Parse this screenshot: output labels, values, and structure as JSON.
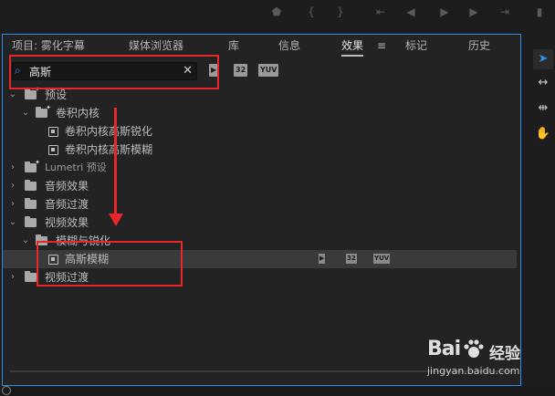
{
  "transport": {
    "icons": [
      "marker-icon",
      "in-point-icon",
      "out-point-icon",
      "go-to-in-icon",
      "step-back-icon",
      "play-icon",
      "step-forward-icon",
      "go-to-out-icon"
    ]
  },
  "tabs": [
    {
      "label": "项目: 雾化字幕"
    },
    {
      "label": "媒体浏览器"
    },
    {
      "label": "库"
    },
    {
      "label": "信息"
    },
    {
      "label": "效果",
      "active": true
    },
    {
      "label": "标记"
    },
    {
      "label": "历史"
    }
  ],
  "search": {
    "value": "高斯",
    "placeholder": ""
  },
  "filters": {
    "accelerated": "▶",
    "bit32": "32",
    "yuv": "YUV"
  },
  "tree": [
    {
      "label": "预设",
      "level": 0,
      "expanded": true,
      "type": "folder-star"
    },
    {
      "label": "卷积内核",
      "level": 1,
      "expanded": true,
      "type": "folder-star"
    },
    {
      "label": "卷积内核高斯锐化",
      "level": 2,
      "type": "preset"
    },
    {
      "label": "卷积内核高斯模糊",
      "level": 2,
      "type": "preset"
    },
    {
      "label": "Lumetri 预设",
      "level": 0,
      "expanded": false,
      "type": "folder-star"
    },
    {
      "label": "音频效果",
      "level": 0,
      "expanded": false,
      "type": "folder"
    },
    {
      "label": "音频过渡",
      "level": 0,
      "expanded": false,
      "type": "folder"
    },
    {
      "label": "视频效果",
      "level": 0,
      "expanded": true,
      "type": "folder"
    },
    {
      "label": "模糊与锐化",
      "level": 1,
      "expanded": true,
      "type": "folder"
    },
    {
      "label": "高斯模糊",
      "level": 2,
      "type": "effect",
      "selected": true,
      "badges": [
        "▶",
        "32",
        "YUV"
      ]
    },
    {
      "label": "视频过渡",
      "level": 0,
      "expanded": false,
      "type": "folder"
    }
  ],
  "tools": [
    "selection-tool-icon",
    "ripple-edit-icon",
    "slip-tool-icon",
    "hand-tool-icon"
  ],
  "watermark": {
    "logo": "Bai",
    "brand": "经验",
    "url": "jingyan.baidu.com"
  },
  "colors": {
    "accent": "#2d8ceb",
    "annotation": "#e8262b",
    "panel": "#232323",
    "selected_row": "#3a3a3a"
  }
}
